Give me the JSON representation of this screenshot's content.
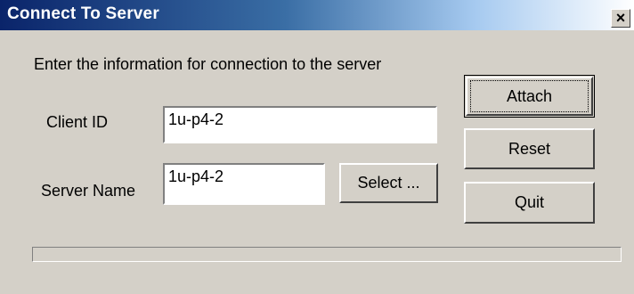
{
  "window": {
    "title": "Connect To Server",
    "close_symbol": "×"
  },
  "instructions": "Enter the information for connection to the server",
  "client_id": {
    "label": "Client ID",
    "value": "1u-p4-2"
  },
  "server_name": {
    "label": "Server Name",
    "value": "1u-p4-2"
  },
  "buttons": {
    "select": "Select ...",
    "attach": "Attach",
    "reset": "Reset",
    "quit": "Quit"
  },
  "progress": {
    "value": 0
  }
}
